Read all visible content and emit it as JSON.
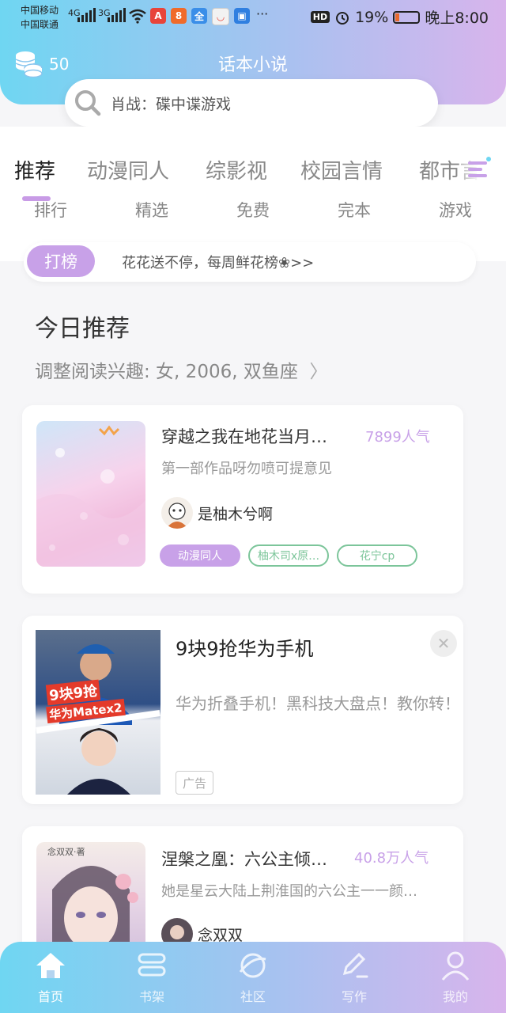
{
  "status_bar": {
    "carrier1": "中国移动",
    "carrier2": "中国联通",
    "net1": "4G",
    "net2": "3G",
    "hd": "HD",
    "battery": "19%",
    "time": "晚上8:00"
  },
  "header": {
    "coins": "50",
    "title": "话本小说",
    "search_placeholder": "肖战：碟中谍游戏"
  },
  "tabs": [
    "推荐",
    "动漫同人",
    "综影视",
    "校园言情",
    "都市言情"
  ],
  "subtabs": [
    "排行",
    "精选",
    "免费",
    "完本",
    "游戏"
  ],
  "rank_bar": {
    "pill": "打榜",
    "text": "花花送不停，每周鲜花榜❀>>"
  },
  "section": {
    "title": "今日推荐",
    "interest": "调整阅读兴趣: 女, 2006, 双鱼座"
  },
  "books": [
    {
      "title": "穿越之我在地花当月…",
      "popularity": "7899人气",
      "desc": "第一部作品呀勿喷可提意见",
      "author": "是柚木兮啊",
      "tags": [
        "动漫同人",
        "柚木司x原…",
        "花宁cp"
      ]
    },
    {
      "title": "涅槃之凰：六公主倾…",
      "popularity": "40.8万人气",
      "desc": "她是星云大陆上荆淮国的六公主一一颜…",
      "author": "念双双"
    }
  ],
  "ad": {
    "title": "9块9抢华为手机",
    "desc": "华为折叠手机！黑科技大盘点！教你转！",
    "badge": "广告",
    "close": "✕",
    "image_text1": "9块9抢",
    "image_text2": "华为Matex2"
  },
  "bottom_nav": [
    "首页",
    "书架",
    "社区",
    "写作",
    "我的"
  ],
  "colors": {
    "accent": "#c8a1e8",
    "header_left": "#6fd6f2",
    "header_right": "#d8b4ec",
    "tag_green": "#7cc59a"
  }
}
